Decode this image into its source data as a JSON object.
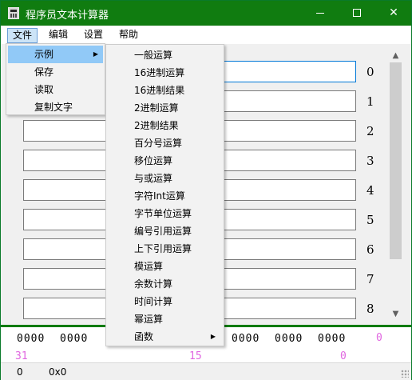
{
  "window": {
    "title": "程序员文本计算器",
    "accent_color": "#107c10",
    "icons": {
      "app": "calculator-icon",
      "minimize": "minimize-icon",
      "maximize": "maximize-icon",
      "close": "close-icon"
    },
    "close_glyph": "✕"
  },
  "menubar": {
    "items": [
      "文件",
      "编辑",
      "设置",
      "帮助"
    ],
    "open_index": 0
  },
  "file_menu": {
    "items": [
      "示例",
      "保存",
      "读取",
      "复制文字"
    ],
    "highlighted_index": 0,
    "submenu_arrow": "▶"
  },
  "examples_submenu": {
    "items": [
      "一般运算",
      "16进制运算",
      "16进制结果",
      "2进制运算",
      "2进制结果",
      "百分号运算",
      "移位运算",
      "与或运算",
      "字符Int运算",
      "字节单位运算",
      "编号引用运算",
      "上下引用运算",
      "模运算",
      "余数计算",
      "时间计算",
      "幂运算",
      "函数"
    ],
    "has_submenu_index": 16,
    "submenu_arrow": "▶"
  },
  "expression_rows": {
    "labels": [
      "0",
      "1",
      "2",
      "3",
      "4",
      "5",
      "6",
      "7",
      "8"
    ],
    "values": [
      "",
      "",
      "",
      "",
      "",
      "",
      "",
      "",
      ""
    ],
    "focused_index": 0
  },
  "scrollbar": {
    "up_arrow": "▲",
    "down_arrow": "▼"
  },
  "bit_display": {
    "groups_visible": [
      "0000",
      "0000",
      "0000",
      "0000",
      "0000"
    ],
    "index_labels": [
      "31",
      "15",
      "0",
      "0"
    ],
    "index_color": "#e066e0"
  },
  "statusbar": {
    "decimal": "0",
    "hex": "0x0"
  }
}
